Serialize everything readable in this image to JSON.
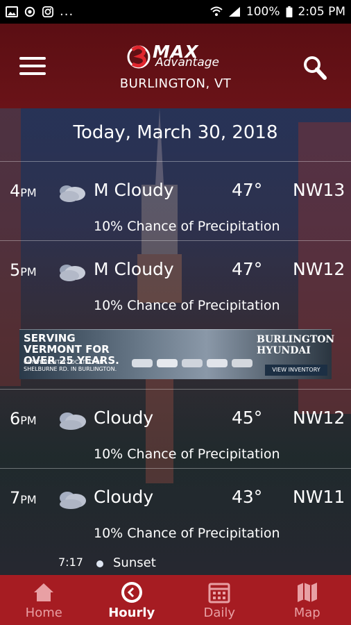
{
  "status_bar": {
    "left_icons": [
      "image-icon",
      "sync-icon",
      "instagram-icon"
    ],
    "more": "...",
    "battery": "100%",
    "time": "2:05 PM"
  },
  "header": {
    "logo_max": "MAX",
    "logo_advantage": "Advantage",
    "location": "BURLINGTON, VT",
    "bg_color": "#6a1318"
  },
  "main": {
    "date": "Today, March 30, 2018",
    "hours": [
      {
        "hour": "4",
        "period": "PM",
        "condition": "M Cloudy",
        "temp": "47°",
        "wind": "NW13",
        "precip": "10% Chance of Precipitation",
        "icon": "mostly-cloudy-icon"
      },
      {
        "hour": "5",
        "period": "PM",
        "condition": "M Cloudy",
        "temp": "47°",
        "wind": "NW12",
        "precip": "10% Chance of Precipitation",
        "icon": "mostly-cloudy-icon"
      },
      {
        "hour": "6",
        "period": "PM",
        "condition": "Cloudy",
        "temp": "45°",
        "wind": "NW12",
        "precip": "10% Chance of Precipitation",
        "icon": "cloudy-icon"
      },
      {
        "hour": "7",
        "period": "PM",
        "condition": "Cloudy",
        "temp": "43°",
        "wind": "NW11",
        "precip": "10% Chance of Precipitation",
        "icon": "cloudy-icon"
      }
    ],
    "sunset": {
      "time": "7:17",
      "label": "Sunset"
    }
  },
  "ad": {
    "headline": "SERVING VERMONT FOR OVER 25 YEARS.",
    "sub": "CONVENIENTLY LOCATED ON SHELBURNE RD. IN BURLINGTON.",
    "brand_line1": "BURLINGTON",
    "brand_line2": "HYUNDAI",
    "cta": "VIEW INVENTORY"
  },
  "nav": {
    "bg_color": "#a61c22",
    "items": [
      {
        "label": "Home",
        "icon": "home-icon",
        "active": false
      },
      {
        "label": "Hourly",
        "icon": "clock-icon",
        "active": true
      },
      {
        "label": "Daily",
        "icon": "calendar-icon",
        "active": false
      },
      {
        "label": "Map",
        "icon": "map-icon",
        "active": false
      }
    ]
  }
}
